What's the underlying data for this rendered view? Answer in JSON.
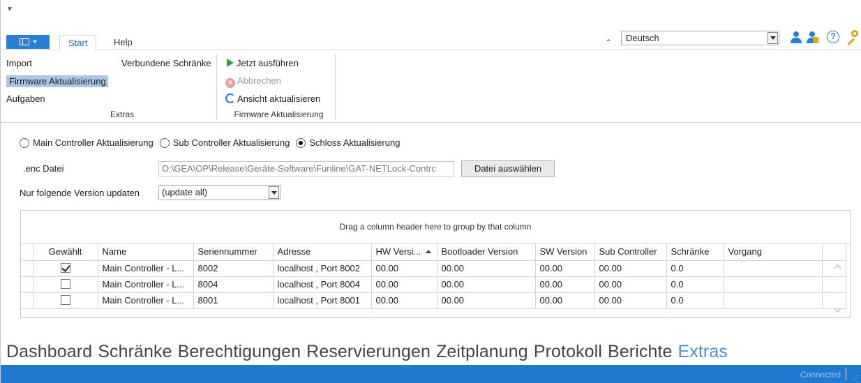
{
  "ribbon": {
    "tabs": [
      {
        "label": "Start",
        "active": true
      },
      {
        "label": "Help",
        "active": false
      }
    ],
    "language": "Deutsch",
    "extras_group": {
      "items": [
        "Import",
        "Verbundene Schränke",
        "Firmware Aktualisierung",
        "Aufgaben"
      ],
      "selected": "Firmware Aktualisierung",
      "label": "Extras"
    },
    "firmware_group": {
      "run_label": "Jetzt ausführen",
      "cancel_label": "Abbrechen",
      "refresh_label": "Ansicht aktualisieren",
      "label": "Firmware Aktualisierung"
    }
  },
  "update_type": {
    "options": [
      "Main Controller Aktualisierung",
      "Sub Controller Aktualisierung",
      "Schloss Aktualisierung"
    ],
    "selected": "Schloss Aktualisierung"
  },
  "enc_file": {
    "label": ".enc Datei",
    "value": "O:\\GEA\\OP\\Release\\Geräte-Software\\Funline\\GAT-NETLock-Contrc",
    "button": "Datei auswählen"
  },
  "version_filter": {
    "label": "Nur folgende Version updaten",
    "value": "(update all)"
  },
  "grid": {
    "group_panel": "Drag a column header here to group by that column",
    "columns": [
      "Gewählt",
      "Name",
      "Seriennummer",
      "Adresse",
      "HW Versi...",
      "Bootloader Version",
      "SW Version",
      "Sub Controller",
      "Schränke",
      "Vorgang"
    ],
    "rows": [
      {
        "checked": true,
        "name": "Main Controller - L...",
        "serial": "8002",
        "address": "localhost , Port 8002",
        "hw": "00.00",
        "bootloader": "00.00",
        "sw": "00.00",
        "sub": "00.00",
        "cabinets": "0.0",
        "process": ""
      },
      {
        "checked": false,
        "name": "Main Controller - L...",
        "serial": "8004",
        "address": "localhost , Port 8004",
        "hw": "00.00",
        "bootloader": "00.00",
        "sw": "00.00",
        "sub": "00.00",
        "cabinets": "0.0",
        "process": ""
      },
      {
        "checked": false,
        "name": "Main Controller - L...",
        "serial": "8001",
        "address": "localhost , Port 8001",
        "hw": "00.00",
        "bootloader": "00.00",
        "sw": "00.00",
        "sub": "00.00",
        "cabinets": "0.0",
        "process": ""
      }
    ]
  },
  "nav": {
    "items": [
      "Dashboard",
      "Schränke",
      "Berechtigungen",
      "Reservierungen",
      "Zeitplanung",
      "Protokoll",
      "Berichte",
      "Extras"
    ],
    "active": "Extras"
  },
  "status": {
    "connection": "Connected"
  },
  "colors": {
    "accent": "#1f79d0",
    "selection": "#a7c8e8",
    "run": "#2aa33a"
  }
}
